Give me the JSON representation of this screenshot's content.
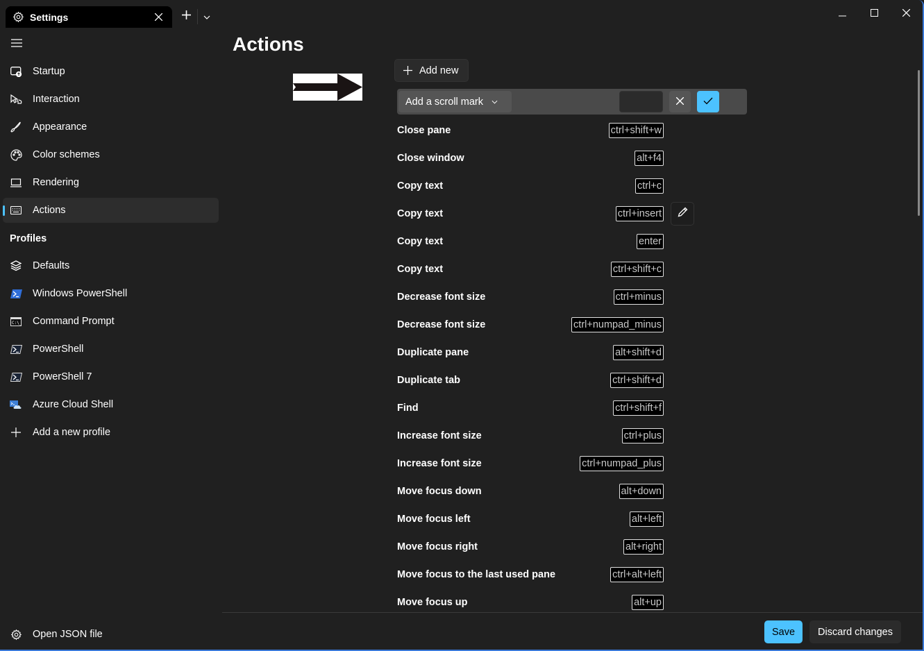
{
  "titlebar": {
    "tab_title": "Settings",
    "tab_icon": "gear-icon",
    "new_tab_icon": "plus-icon",
    "dropdown_icon": "chevron-down-icon",
    "window_controls": [
      "minimize",
      "maximize",
      "close"
    ]
  },
  "sidebar": {
    "menu_icon": "hamburger-icon",
    "items": [
      {
        "label": "Startup",
        "icon": "startup-icon"
      },
      {
        "label": "Interaction",
        "icon": "cursor-hand-icon"
      },
      {
        "label": "Appearance",
        "icon": "brush-icon"
      },
      {
        "label": "Color schemes",
        "icon": "palette-icon"
      },
      {
        "label": "Rendering",
        "icon": "laptop-icon"
      },
      {
        "label": "Actions",
        "icon": "keyboard-icon",
        "selected": true
      }
    ],
    "profiles_header": "Profiles",
    "profiles": [
      {
        "label": "Defaults",
        "icon": "layers-icon"
      },
      {
        "label": "Windows PowerShell",
        "icon": "powershell-blue-icon"
      },
      {
        "label": "Command Prompt",
        "icon": "cmd-icon"
      },
      {
        "label": "PowerShell",
        "icon": "powershell-icon"
      },
      {
        "label": "PowerShell 7",
        "icon": "powershell-icon"
      },
      {
        "label": "Azure Cloud Shell",
        "icon": "azure-cloud-icon"
      },
      {
        "label": "Add a new profile",
        "icon": "plus-icon"
      }
    ],
    "open_json": "Open JSON file"
  },
  "main": {
    "title": "Actions",
    "add_new_label": "Add new",
    "edit_row": {
      "selected_action": "Add a scroll mark",
      "keys_value": ""
    },
    "actions": [
      {
        "name": "Close pane",
        "keys": "ctrl+shift+w"
      },
      {
        "name": "Close window",
        "keys": "alt+f4"
      },
      {
        "name": "Copy text",
        "keys": "ctrl+c"
      },
      {
        "name": "Copy text",
        "keys": "ctrl+insert",
        "hovered": true
      },
      {
        "name": "Copy text",
        "keys": "enter"
      },
      {
        "name": "Copy text",
        "keys": "ctrl+shift+c"
      },
      {
        "name": "Decrease font size",
        "keys": "ctrl+minus"
      },
      {
        "name": "Decrease font size",
        "keys": "ctrl+numpad_minus"
      },
      {
        "name": "Duplicate pane",
        "keys": "alt+shift+d"
      },
      {
        "name": "Duplicate tab",
        "keys": "ctrl+shift+d"
      },
      {
        "name": "Find",
        "keys": "ctrl+shift+f"
      },
      {
        "name": "Increase font size",
        "keys": "ctrl+plus"
      },
      {
        "name": "Increase font size",
        "keys": "ctrl+numpad_plus"
      },
      {
        "name": "Move focus down",
        "keys": "alt+down"
      },
      {
        "name": "Move focus left",
        "keys": "alt+left"
      },
      {
        "name": "Move focus right",
        "keys": "alt+right"
      },
      {
        "name": "Move focus to the last used pane",
        "keys": "ctrl+alt+left"
      },
      {
        "name": "Move focus up",
        "keys": "alt+up"
      }
    ]
  },
  "footer": {
    "save_label": "Save",
    "discard_label": "Discard changes"
  },
  "colors": {
    "accent": "#4cc2ff",
    "background": "#202020",
    "window_border": "#3a78d8"
  }
}
